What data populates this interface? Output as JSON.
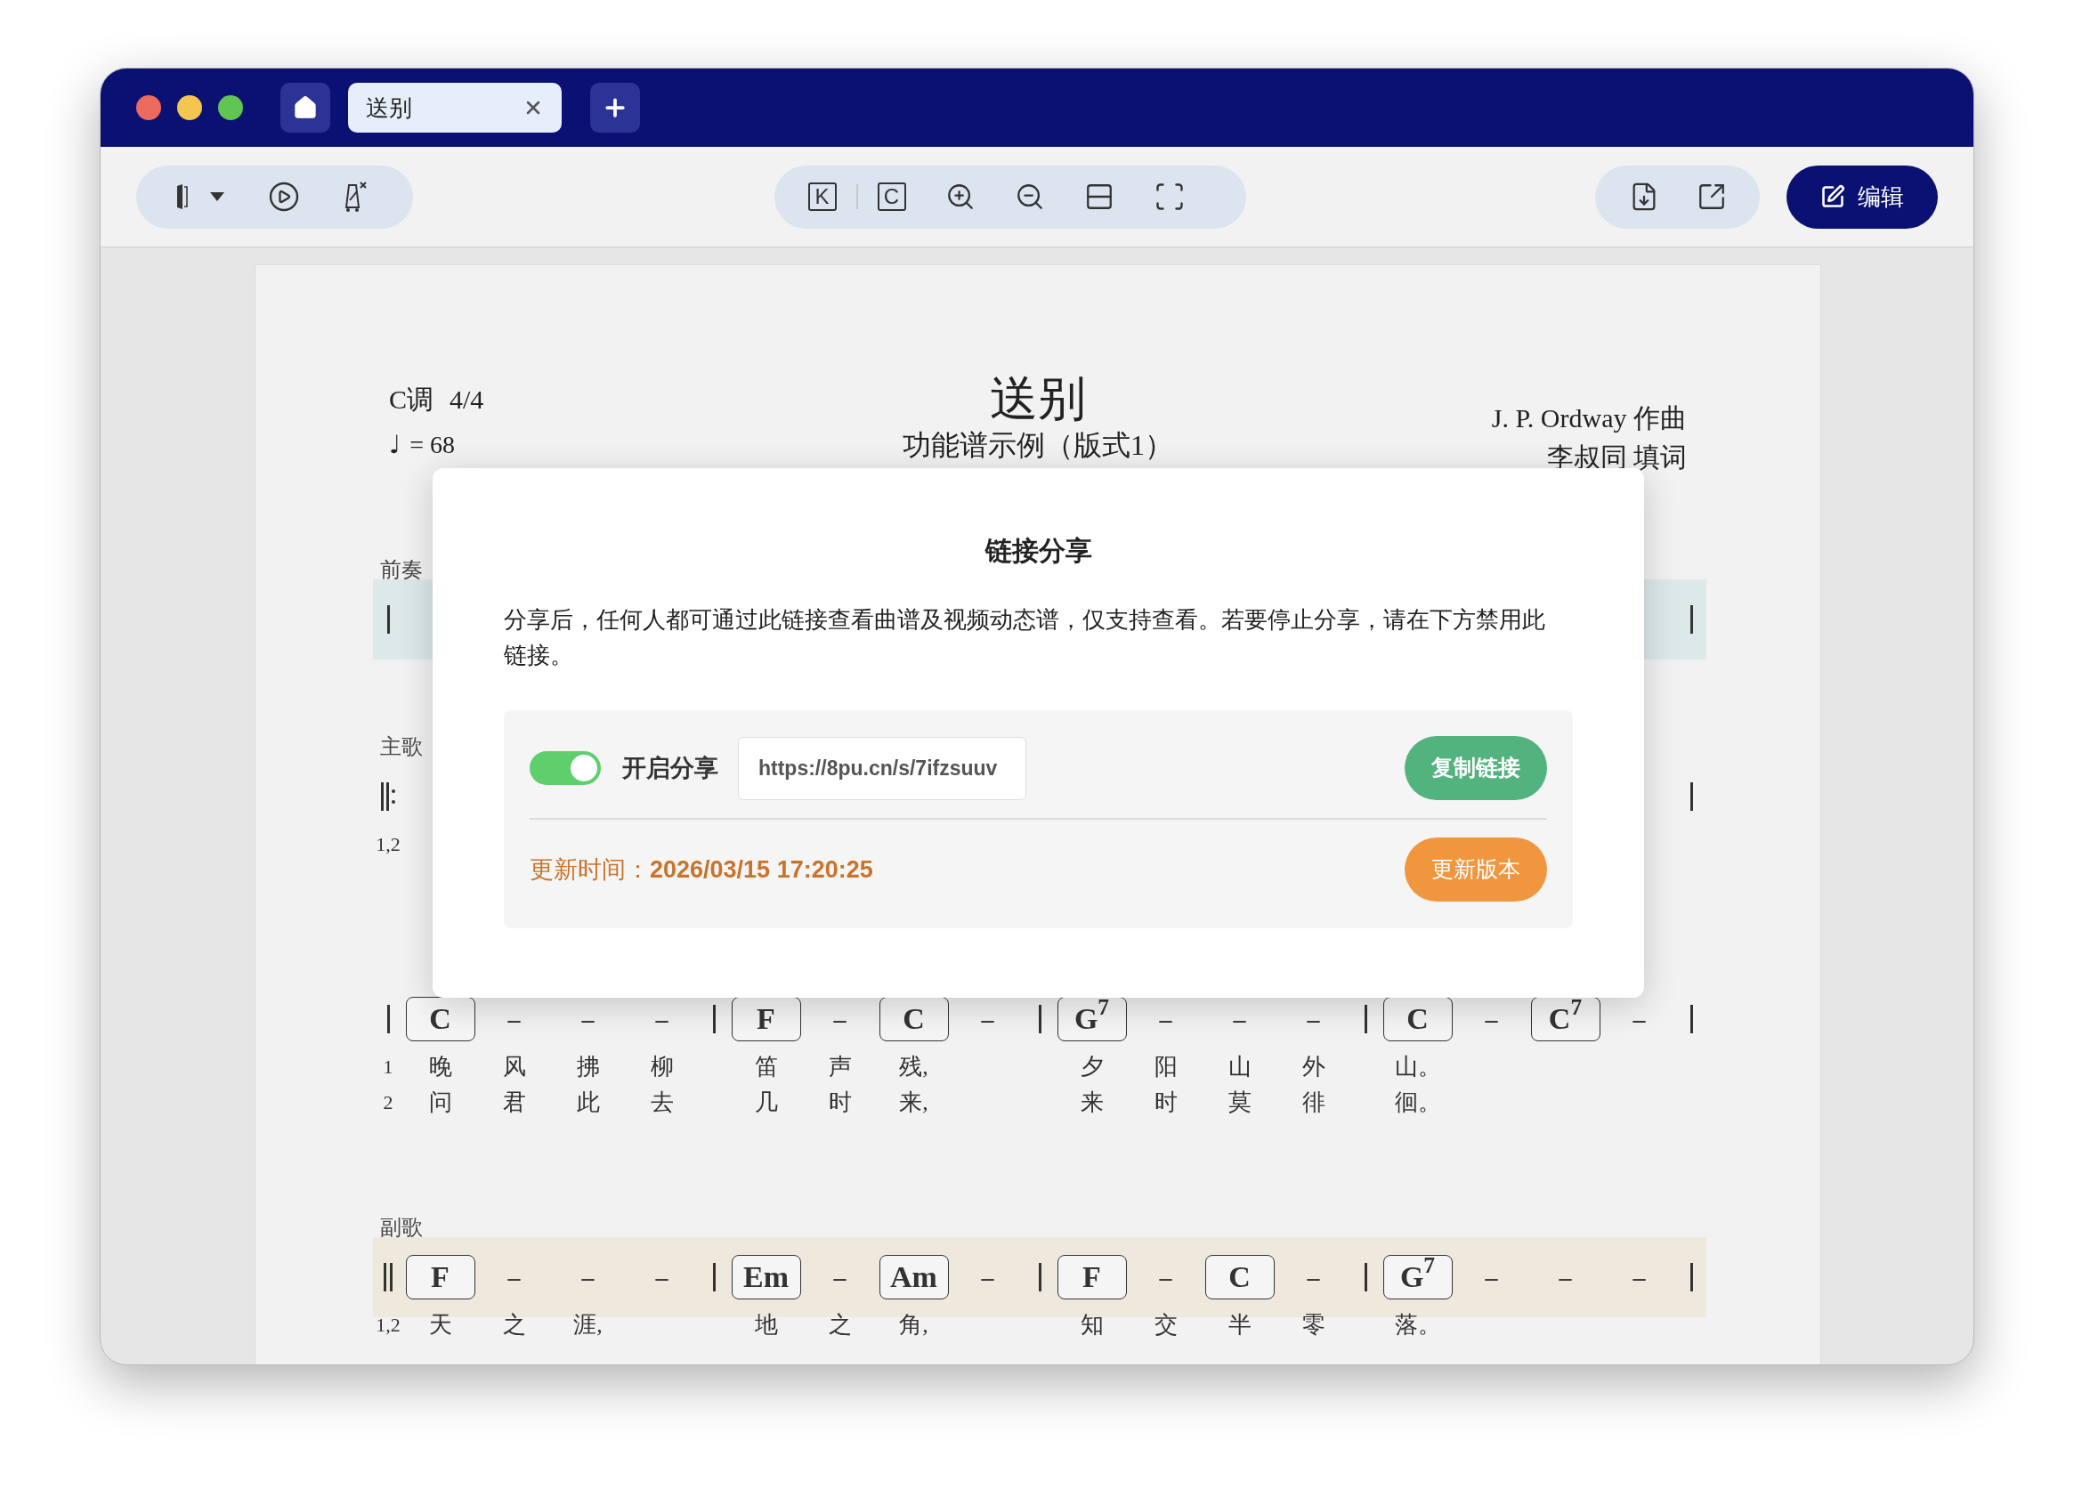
{
  "window": {
    "tabs": [
      {
        "label": "送别",
        "selected": true
      }
    ]
  },
  "toolbar": {
    "key_button": "K",
    "chord_button": "C",
    "edit_button": "编辑"
  },
  "score": {
    "key": "C调",
    "meter": "4/4",
    "tempo_mark": "♩",
    "tempo": "= 68",
    "title": "送别",
    "subtitle": "功能谱示例（版式1）",
    "composer": "J. P. Ordway 作曲",
    "lyricist": "李叔同 填词",
    "rows": [
      {
        "label": "前奏",
        "color": "#dde9e9",
        "start_bar": {
          "kind": "single"
        },
        "end_bar": {
          "kind": "single"
        }
      },
      {
        "label": "主歌",
        "start_bar": {
          "kind": "repeat"
        },
        "end_bar": {
          "kind": "single"
        },
        "verses": [
          "1,2"
        ]
      },
      {
        "start_bar": {
          "kind": "single"
        },
        "end_bar": {
          "kind": "single"
        },
        "verses": [
          "1",
          "2"
        ],
        "measures": [
          {
            "beats": [
              {
                "kind": "chord",
                "text": "C"
              },
              {
                "kind": "dash",
                "text": "–"
              },
              {
                "kind": "dash",
                "text": "–"
              },
              {
                "kind": "dash",
                "text": "–"
              }
            ],
            "lyrics": [
              [
                "晚",
                "风",
                "拂",
                "柳"
              ],
              [
                "问",
                "君",
                "此",
                "去"
              ]
            ]
          },
          {
            "beats": [
              {
                "kind": "chord",
                "text": "F"
              },
              {
                "kind": "dash",
                "text": "–"
              },
              {
                "kind": "chord",
                "text": "C"
              },
              {
                "kind": "dash",
                "text": "–"
              }
            ],
            "lyrics": [
              [
                "笛",
                "声",
                "残,"
              ],
              [
                "几",
                "时",
                "来,"
              ]
            ]
          },
          {
            "beats": [
              {
                "kind": "chord",
                "text": "G$^{7}$"
              },
              {
                "kind": "dash",
                "text": "–"
              },
              {
                "kind": "dash",
                "text": "–"
              },
              {
                "kind": "dash",
                "text": "–"
              }
            ],
            "lyrics": [
              [
                "夕",
                "阳",
                "山",
                "外"
              ],
              [
                "来",
                "时",
                "莫",
                "徘"
              ]
            ]
          },
          {
            "beats": [
              {
                "kind": "chord",
                "text": "C"
              },
              {
                "kind": "dash",
                "text": "–"
              },
              {
                "kind": "chord",
                "text": "C$^{7}$"
              },
              {
                "kind": "dash",
                "text": "–"
              }
            ],
            "lyrics": [
              [
                "山。"
              ],
              [
                "徊。"
              ]
            ]
          }
        ]
      },
      {
        "label": "副歌",
        "color": "#efe8dd",
        "start_bar": {
          "kind": "double"
        },
        "end_bar": {
          "kind": "single"
        },
        "verses": [
          "1,2"
        ],
        "measures": [
          {
            "beats": [
              {
                "kind": "chord",
                "text": "F"
              },
              {
                "kind": "dash",
                "text": "–"
              },
              {
                "kind": "dash",
                "text": "–"
              },
              {
                "kind": "dash",
                "text": "–"
              }
            ],
            "lyrics": [
              [
                "天",
                "之",
                "涯,"
              ]
            ]
          },
          {
            "beats": [
              {
                "kind": "chord",
                "text": "Em"
              },
              {
                "kind": "dash",
                "text": "–"
              },
              {
                "kind": "chord",
                "text": "Am"
              },
              {
                "kind": "dash",
                "text": "–"
              }
            ],
            "lyrics": [
              [
                "地",
                "之",
                "角,"
              ]
            ]
          },
          {
            "beats": [
              {
                "kind": "chord",
                "text": "F"
              },
              {
                "kind": "dash",
                "text": "–"
              },
              {
                "kind": "chord",
                "text": "C"
              },
              {
                "kind": "dash",
                "text": "–"
              }
            ],
            "lyrics": [
              [
                "知",
                "交",
                "半",
                "零"
              ]
            ]
          },
          {
            "beats": [
              {
                "kind": "chord",
                "text": "G$^{7}$"
              },
              {
                "kind": "dash",
                "text": "–"
              },
              {
                "kind": "dash",
                "text": "–"
              },
              {
                "kind": "dash",
                "text": "–"
              }
            ],
            "lyrics": [
              [
                "落。"
              ]
            ]
          }
        ]
      }
    ]
  },
  "share_dialog": {
    "title": "链接分享",
    "description": "分享后，任何人都可通过此链接查看曲谱及视频动态谱，仅支持查看。若要停止分享，请在下方禁用此链接。",
    "sharing_on": true,
    "toggle_label": "开启分享",
    "link": "https://8pu.cn/s/7ifzsuuv",
    "copy_button": "复制链接",
    "updated_label": "更新时间：",
    "updated_time": "2026/03/15 17:20:25",
    "update_button": "更新版本"
  }
}
